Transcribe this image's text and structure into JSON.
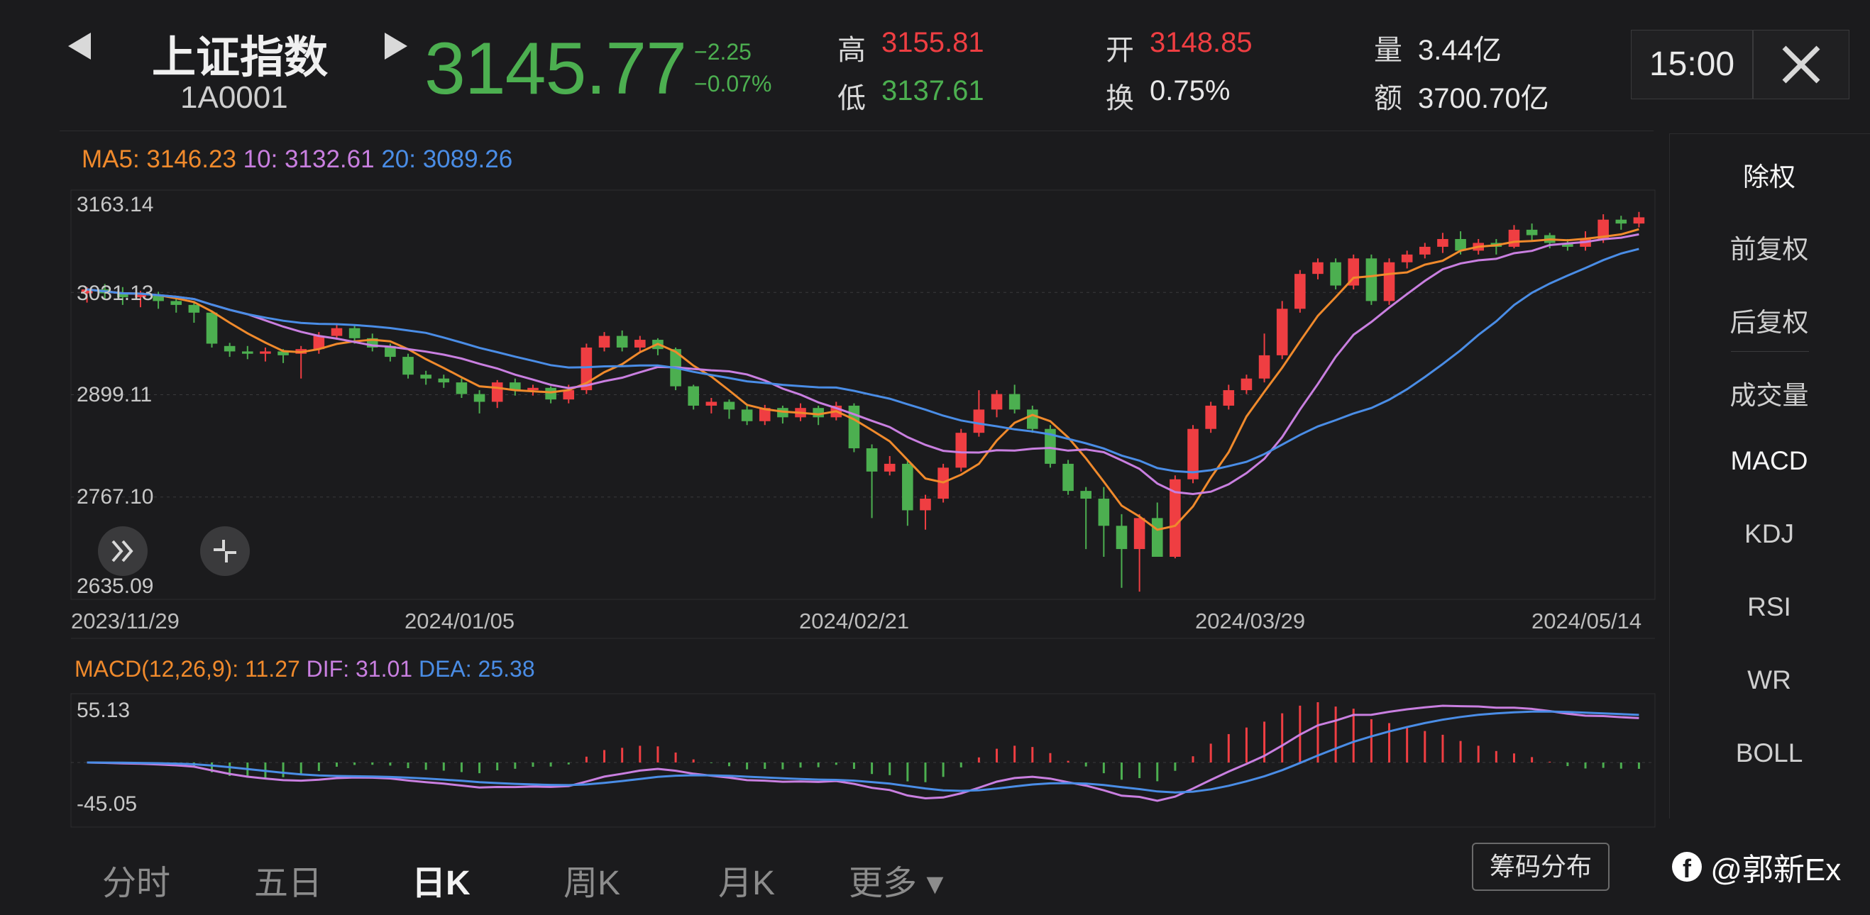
{
  "header": {
    "prev_icon": "triangle-left-icon",
    "next_icon": "triangle-right-icon",
    "name": "上证指数",
    "code": "1A0001",
    "price": "3145.77",
    "change": "−2.25",
    "change_pct": "−0.07%",
    "stats": {
      "high_label": "高",
      "high_value": "3155.81",
      "low_label": "低",
      "low_value": "3137.61",
      "open_label": "开",
      "open_value": "3148.85",
      "turnover_label": "换",
      "turnover_value": "0.75%",
      "volume_label": "量",
      "volume_value": "3.44亿",
      "amount_label": "额",
      "amount_value": "3700.70亿"
    },
    "time": "15:00",
    "close_icon": "close-icon"
  },
  "ma_legend": {
    "ma5": "MA5: 3146.23",
    "ma10": "10: 3132.61",
    "ma20": "20: 3089.26"
  },
  "price_axis": [
    "3163.14",
    "3031.13",
    "2899.11",
    "2767.10",
    "2635.09"
  ],
  "date_axis": [
    "2023/11/29",
    "2024/01/05",
    "2024/02/21",
    "2024/03/29",
    "2024/05/14"
  ],
  "macd_legend": {
    "macd": "MACD(12,26,9): 11.27",
    "dif": "DIF: 31.01",
    "dea": "DEA: 25.38"
  },
  "macd_axis": [
    "55.13",
    "-45.05"
  ],
  "side_menu": [
    "除权",
    "前复权",
    "后复权",
    "成交量",
    "MACD",
    "KDJ",
    "RSI",
    "WR",
    "BOLL"
  ],
  "controls": {
    "expand_icon": "double-chevron-right-icon",
    "shrink_icon": "shrink-arrows-icon"
  },
  "tabs": [
    "分时",
    "五日",
    "日K",
    "周K",
    "月K",
    "更多 ▾"
  ],
  "active_tab": "日K",
  "chip_button": "筹码分布",
  "watermark": "@郭新Ex",
  "colors": {
    "up": "#ef3e42",
    "down": "#4caf50",
    "ma5": "#f08a2c",
    "ma10": "#c97fe0",
    "ma20": "#4a8de6",
    "background": "#1b1b1d"
  },
  "chart_data": {
    "type": "candlestick",
    "ylim": [
      2635.09,
      3163.14
    ],
    "candles": [
      [
        3030,
        3035,
        3018,
        3038
      ],
      [
        3035,
        3030,
        3022,
        3042
      ],
      [
        3030,
        3025,
        3015,
        3038
      ],
      [
        3025,
        3028,
        3012,
        3033
      ],
      [
        3028,
        3020,
        3010,
        3032
      ],
      [
        3020,
        3015,
        3005,
        3026
      ],
      [
        3015,
        3005,
        2992,
        3020
      ],
      [
        3005,
        2965,
        2960,
        3008
      ],
      [
        2962,
        2955,
        2948,
        2966
      ],
      [
        2955,
        2952,
        2945,
        2962
      ],
      [
        2952,
        2955,
        2942,
        2960
      ],
      [
        2955,
        2950,
        2940,
        2958
      ],
      [
        2952,
        2958,
        2920,
        2962
      ],
      [
        2958,
        2975,
        2952,
        2980
      ],
      [
        2975,
        2985,
        2970,
        2990
      ],
      [
        2985,
        2972,
        2965,
        2990
      ],
      [
        2972,
        2960,
        2955,
        2978
      ],
      [
        2962,
        2948,
        2942,
        2965
      ],
      [
        2948,
        2925,
        2920,
        2952
      ],
      [
        2925,
        2920,
        2912,
        2930
      ],
      [
        2920,
        2915,
        2908,
        2925
      ],
      [
        2915,
        2900,
        2895,
        2920
      ],
      [
        2900,
        2890,
        2875,
        2905
      ],
      [
        2890,
        2915,
        2882,
        2918
      ],
      [
        2915,
        2905,
        2898,
        2920
      ],
      [
        2905,
        2908,
        2898,
        2912
      ],
      [
        2908,
        2893,
        2888,
        2910
      ],
      [
        2893,
        2905,
        2888,
        2912
      ],
      [
        2905,
        2960,
        2900,
        2965
      ],
      [
        2960,
        2975,
        2955,
        2980
      ],
      [
        2975,
        2960,
        2955,
        2982
      ],
      [
        2960,
        2970,
        2955,
        2975
      ],
      [
        2970,
        2958,
        2950,
        2972
      ],
      [
        2958,
        2910,
        2905,
        2960
      ],
      [
        2910,
        2885,
        2880,
        2912
      ],
      [
        2885,
        2890,
        2875,
        2895
      ],
      [
        2890,
        2880,
        2868,
        2893
      ],
      [
        2880,
        2865,
        2860,
        2885
      ],
      [
        2865,
        2882,
        2860,
        2886
      ],
      [
        2882,
        2870,
        2862,
        2885
      ],
      [
        2870,
        2882,
        2865,
        2888
      ],
      [
        2882,
        2870,
        2860,
        2885
      ],
      [
        2870,
        2885,
        2866,
        2890
      ],
      [
        2885,
        2830,
        2825,
        2888
      ],
      [
        2830,
        2800,
        2740,
        2835
      ],
      [
        2800,
        2810,
        2795,
        2820
      ],
      [
        2810,
        2750,
        2730,
        2815
      ],
      [
        2750,
        2765,
        2725,
        2770
      ],
      [
        2765,
        2805,
        2760,
        2810
      ],
      [
        2805,
        2850,
        2800,
        2855
      ],
      [
        2850,
        2880,
        2845,
        2905
      ],
      [
        2880,
        2900,
        2870,
        2905
      ],
      [
        2900,
        2880,
        2875,
        2912
      ],
      [
        2880,
        2855,
        2850,
        2885
      ],
      [
        2855,
        2810,
        2805,
        2860
      ],
      [
        2810,
        2775,
        2770,
        2815
      ],
      [
        2775,
        2765,
        2700,
        2780
      ],
      [
        2765,
        2730,
        2690,
        2780
      ],
      [
        2730,
        2700,
        2650,
        2745
      ],
      [
        2700,
        2740,
        2645,
        2745
      ],
      [
        2740,
        2690,
        2690,
        2760
      ],
      [
        2690,
        2790,
        2688,
        2795
      ],
      [
        2790,
        2855,
        2785,
        2860
      ],
      [
        2855,
        2885,
        2850,
        2890
      ],
      [
        2885,
        2905,
        2880,
        2912
      ],
      [
        2905,
        2920,
        2900,
        2925
      ],
      [
        2920,
        2950,
        2915,
        2978
      ],
      [
        2950,
        3010,
        2945,
        3020
      ],
      [
        3010,
        3055,
        3005,
        3060
      ],
      [
        3055,
        3070,
        3048,
        3075
      ],
      [
        3070,
        3040,
        3035,
        3075
      ],
      [
        3040,
        3075,
        3035,
        3080
      ],
      [
        3075,
        3020,
        3015,
        3080
      ],
      [
        3020,
        3070,
        3015,
        3075
      ],
      [
        3070,
        3080,
        3062,
        3085
      ],
      [
        3080,
        3090,
        3075,
        3095
      ],
      [
        3090,
        3100,
        3082,
        3108
      ],
      [
        3100,
        3085,
        3080,
        3110
      ],
      [
        3085,
        3095,
        3080,
        3100
      ],
      [
        3095,
        3090,
        3080,
        3100
      ],
      [
        3090,
        3112,
        3088,
        3118
      ],
      [
        3112,
        3105,
        3098,
        3120
      ],
      [
        3105,
        3095,
        3088,
        3108
      ],
      [
        3095,
        3090,
        3085,
        3100
      ],
      [
        3090,
        3100,
        3085,
        3110
      ],
      [
        3100,
        3125,
        3095,
        3132
      ],
      [
        3125,
        3120,
        3112,
        3130
      ],
      [
        3120,
        3128,
        3115,
        3135
      ]
    ]
  }
}
